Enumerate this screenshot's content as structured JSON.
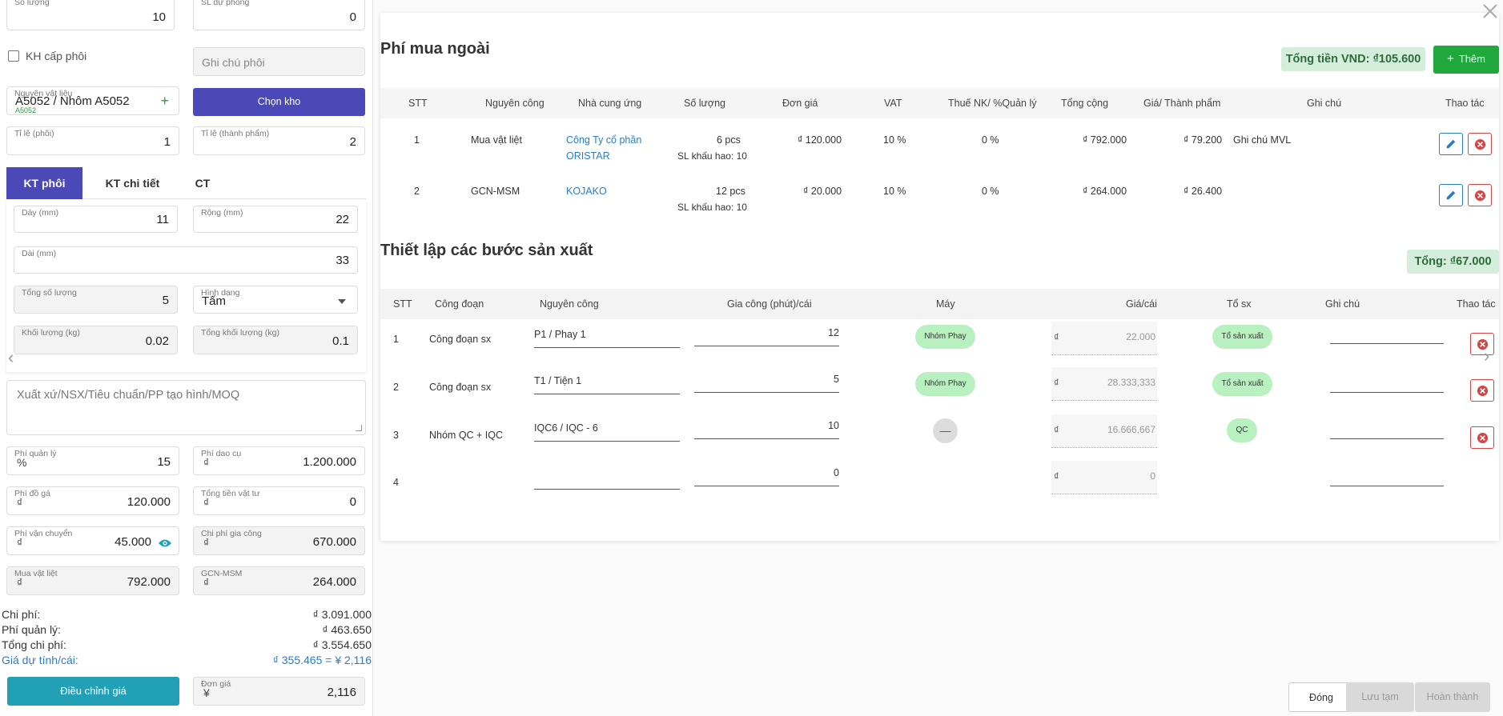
{
  "left": {
    "so_luong": {
      "label": "Số lượng",
      "value": "10"
    },
    "sl_du_phong": {
      "label": "SL dự phòng",
      "value": "0"
    },
    "kh_cap_phoi": {
      "label": "KH cấp phôi"
    },
    "ghi_chu_phoi": {
      "placeholder": "Ghi chú phôi"
    },
    "nguyen_vat_lieu": {
      "label": "Nguyên vật liệu",
      "value": "A5052 / Nhôm A5052",
      "sub": "A5052"
    },
    "chon_kho": "Chọn kho",
    "ti_le_phoi": {
      "label": "Tỉ lệ (phôi)",
      "value": "1"
    },
    "ti_le_thanh_pham": {
      "label": "Tỉ lệ (thành phẩm)",
      "value": "2"
    },
    "tabs": [
      "KT phôi",
      "KT chi tiết",
      "CT"
    ],
    "day": {
      "label": "Dày (mm)",
      "value": "11"
    },
    "rong": {
      "label": "Rộng (mm)",
      "value": "22"
    },
    "dai": {
      "label": "Dài (mm)",
      "value": "33"
    },
    "tong_so_luong": {
      "label": "Tổng số lượng",
      "value": "5"
    },
    "hinh_dang": {
      "label": "Hình dạng",
      "value": "Tấm"
    },
    "khoi_luong": {
      "label": "Khối lượng (kg)",
      "value": "0.02"
    },
    "tong_khoi_luong": {
      "label": "Tổng khối lượng (kg)",
      "value": "0.1"
    },
    "xuat_xu": {
      "placeholder": "Xuất xứ/NSX/Tiêu chuẩn/PP tạo hình/MOQ"
    },
    "phi_quan_ly": {
      "label": "Phí quản lý",
      "prefix": "%",
      "value": "15"
    },
    "phi_dao_cu": {
      "label": "Phí dao cụ",
      "prefix": "₫",
      "value": "1.200.000"
    },
    "phi_do_ga": {
      "label": "Phí đồ gá",
      "prefix": "₫",
      "value": "120.000"
    },
    "tong_tien_vat_tu": {
      "label": "Tổng tiền vật tư",
      "prefix": "₫",
      "value": "0"
    },
    "phi_van_chuyen": {
      "label": "Phí vận chuyển",
      "prefix": "₫",
      "value": "45.000"
    },
    "chi_phi_gia_cong": {
      "label": "Chi phí gia công",
      "prefix": "₫",
      "value": "670.000"
    },
    "mua_vat_liet": {
      "label": "Mua vật liệt",
      "prefix": "₫",
      "value": "792.000"
    },
    "gcn_msm": {
      "label": "GCN-MSM",
      "prefix": "₫",
      "value": "264.000"
    },
    "summary": [
      {
        "label": "Chi phí:",
        "value": "₫ 3.091.000"
      },
      {
        "label": "Phí quản lý:",
        "value": "₫ 463.650"
      },
      {
        "label": "Tổng chi phí:",
        "value": "₫ 3.554.650"
      },
      {
        "label": "Giá dự tính/cái:",
        "value": "₫ 355.465 = ¥ 2,116"
      }
    ],
    "dieu_chinh_gia": "Điều chỉnh giá",
    "don_gia": {
      "label": "Đơn giá",
      "prefix": "¥",
      "value": "2,116"
    }
  },
  "modal": {
    "section1_title": "Phí mua ngoài",
    "tong_tien": "Tổng tiền VND: ₫105.600",
    "them": "Thêm",
    "table1_headers": [
      "STT",
      "Nguyên công",
      "Nhà cung ứng",
      "Số lượng",
      "Đơn giá",
      "VAT",
      "Thuế NK/ %Quản lý",
      "Tổng cộng",
      "Giá/ Thành phẩm",
      "Ghi chú",
      "Thao tác"
    ],
    "table1_rows": [
      {
        "stt": "1",
        "nguyen_cong": "Mua vật liệt",
        "ncu1": "Công Ty cổ phần",
        "ncu2": "ORISTAR",
        "so_luong": "6 pcs",
        "khau_hao": "SL khấu hao: 10",
        "don_gia": "₫ 120.000",
        "vat": "10 %",
        "thue": "0 %",
        "tong": "₫ 792.000",
        "gia_tp": "₫ 79.200",
        "ghi_chu": "Ghi chú MVL"
      },
      {
        "stt": "2",
        "nguyen_cong": "GCN-MSM",
        "ncu1": "KOJAKO",
        "ncu2": "",
        "so_luong": "12 pcs",
        "khau_hao": "SL khấu hao: 10",
        "don_gia": "₫ 20.000",
        "vat": "10 %",
        "thue": "0 %",
        "tong": "₫ 264.000",
        "gia_tp": "₫ 26.400",
        "ghi_chu": ""
      }
    ],
    "section2_title": "Thiết lập các bước sản xuất",
    "tong2": "Tổng: ₫67.000",
    "table2_headers": [
      "STT",
      "Công đoạn",
      "Nguyên công",
      "Gia công (phút)/cái",
      "Máy",
      "Giá/cái",
      "Tổ sx",
      "Ghi chú",
      "Thao tác"
    ],
    "table2_rows": [
      {
        "stt": "1",
        "cong_doan": "Công đoạn sx",
        "nguyen_cong": "P1 / Phay 1",
        "gia_cong": "12",
        "may": "Nhóm Phay",
        "cur": "₫",
        "gia": "22.000",
        "to_sx": "Tổ sản xuất"
      },
      {
        "stt": "2",
        "cong_doan": "Công đoạn sx",
        "nguyen_cong": "T1 / Tiện 1",
        "gia_cong": "5",
        "may": "Nhóm Phay",
        "cur": "₫",
        "gia": "28.333,333",
        "to_sx": "Tổ sản xuất"
      },
      {
        "stt": "3",
        "cong_doan": "Nhóm QC + IQC",
        "nguyen_cong": "IQC6 / IQC - 6",
        "gia_cong": "10",
        "may": "—",
        "cur": "₫",
        "gia": "16.666,667",
        "to_sx": "QC"
      },
      {
        "stt": "4",
        "cong_doan": "",
        "nguyen_cong": "",
        "gia_cong": "0",
        "may": "",
        "cur": "₫",
        "gia": "0",
        "to_sx": ""
      }
    ],
    "dong": "Đóng",
    "luu_tam": "Lưu tạm",
    "hoan_thanh": "Hoàn thành"
  },
  "colors": {
    "primary": "#4b48b8",
    "teal": "#22a0b5",
    "green": "#20a83c",
    "link": "#2a7ec8",
    "danger": "#d64545"
  }
}
